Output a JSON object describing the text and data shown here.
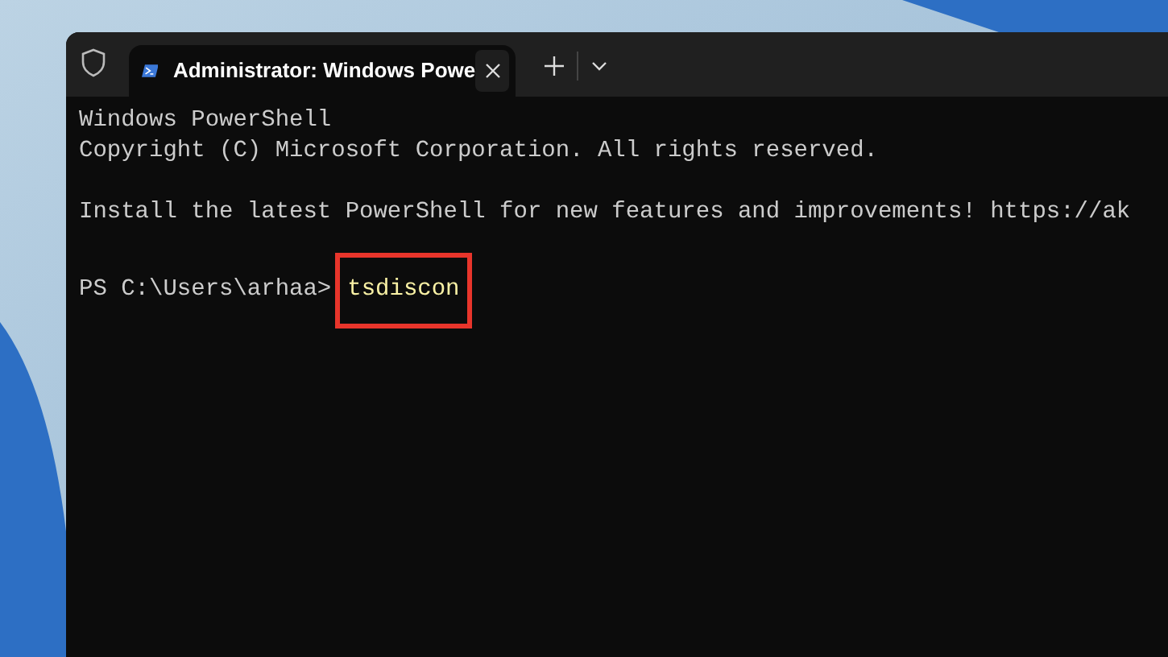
{
  "window": {
    "tab": {
      "title": "Administrator: Windows Powe",
      "selected": true
    }
  },
  "terminal": {
    "lines": [
      {
        "kind": "output",
        "text": "Windows PowerShell"
      },
      {
        "kind": "output",
        "text": "Copyright (C) Microsoft Corporation. All rights reserved."
      },
      {
        "kind": "blank"
      },
      {
        "kind": "output",
        "text": "Install the latest PowerShell for new features and improvements! https://ak"
      },
      {
        "kind": "blank"
      },
      {
        "kind": "prompt",
        "prompt": "PS C:\\Users\\arhaa>",
        "command": "tsdiscon",
        "highlighted": true
      }
    ]
  }
}
